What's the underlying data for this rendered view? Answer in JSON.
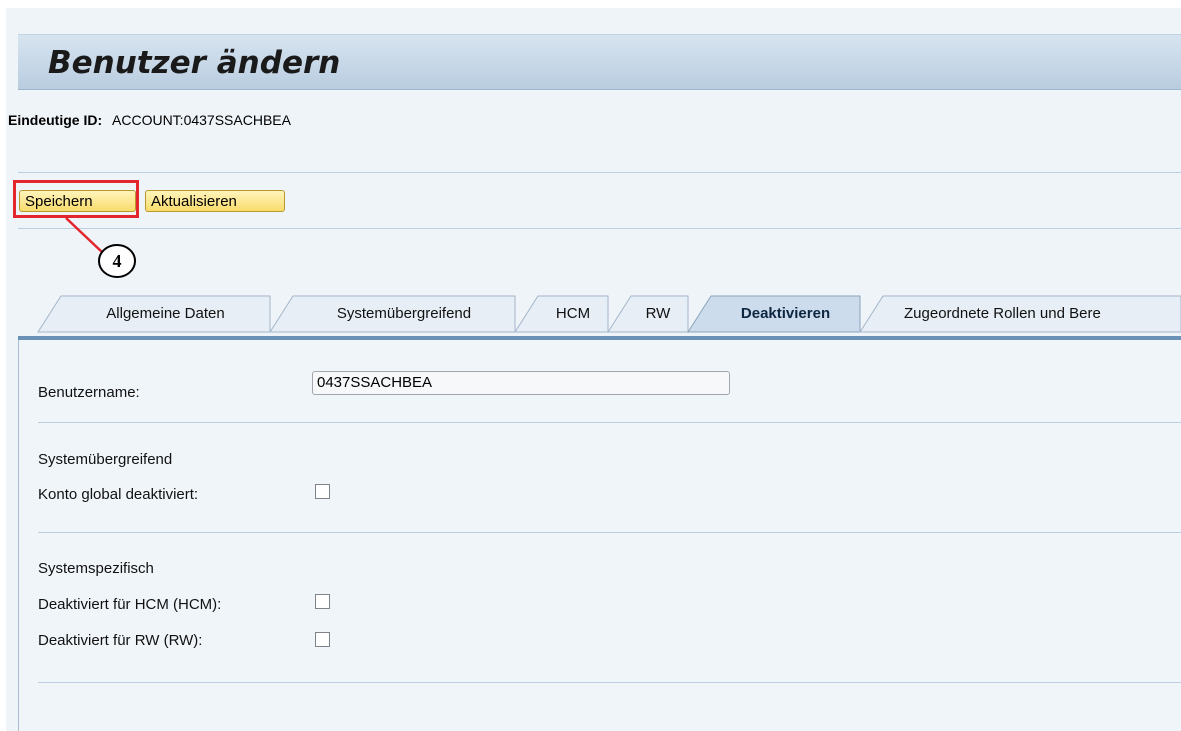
{
  "header": {
    "title": "Benutzer ändern",
    "unique_id_label": "Eindeutige ID:",
    "unique_id_value": "ACCOUNT:0437SSACHBEA"
  },
  "toolbar": {
    "save_label": "Speichern",
    "refresh_label": "Aktualisieren",
    "callout_number": "4",
    "callout_color": "#e3262c"
  },
  "tabs": [
    {
      "label": "Allgemeine Daten",
      "active": false
    },
    {
      "label": "Systemübergreifend",
      "active": false
    },
    {
      "label": "HCM",
      "active": false
    },
    {
      "label": "RW",
      "active": false
    },
    {
      "label": "Deaktivieren",
      "active": true
    },
    {
      "label": "Zugeordnete Rollen und Bere",
      "active": false
    }
  ],
  "form": {
    "username_label": "Benutzername:",
    "username_value": "0437SSACHBEA",
    "cross_system_heading": "Systemübergreifend",
    "global_deactivated_label": "Konto global deaktiviert:",
    "global_deactivated_checked": false,
    "system_specific_heading": "Systemspezifisch",
    "hcm_deactivated_label": "Deaktiviert für HCM (HCM):",
    "hcm_deactivated_checked": false,
    "rw_deactivated_label": "Deaktiviert für RW (RW):",
    "rw_deactivated_checked": false
  },
  "colors": {
    "button_fill": "#f9dc6c",
    "tab_active_fill": "#ccdcec",
    "accent_bar": "#6a90b5"
  }
}
